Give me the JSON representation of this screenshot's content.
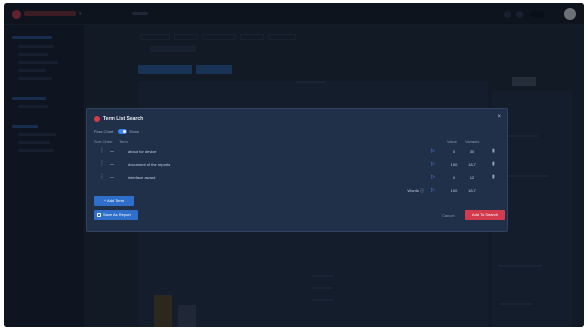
{
  "modal": {
    "title": "Term List Search",
    "close_glyph": "×",
    "flow_label": "Flow Chart",
    "toggle_label": "Show",
    "toggle_on": true,
    "headers": {
      "sort_order": "Sort Order",
      "term": "Term",
      "value": "Value",
      "variants": "Variants"
    },
    "rows": [
      {
        "term": "about for device",
        "volume": "0",
        "variants": "30"
      },
      {
        "term": "document of the reports",
        "volume": "100",
        "variants": "18.7"
      },
      {
        "term": "interface award",
        "volume": "0",
        "variants": "12"
      }
    ],
    "summary": {
      "label": "Words ⓘ",
      "volume": "100",
      "variants": "18.7"
    },
    "add_term_label": "+ Add Term",
    "share_label": "Save As Report",
    "cancel_label": "Cancel",
    "primary_label": "Add To Search"
  },
  "icons": {
    "logo": "app-logo-icon",
    "close": "close-icon",
    "drag": "drag-handle-icon",
    "play": "play-icon",
    "trash": "trash-icon",
    "share": "share-icon"
  },
  "colors": {
    "accent_blue": "#2f6fc9",
    "accent_red": "#d33a4d",
    "modal_bg": "#213049",
    "app_bg": "#1c2536"
  }
}
